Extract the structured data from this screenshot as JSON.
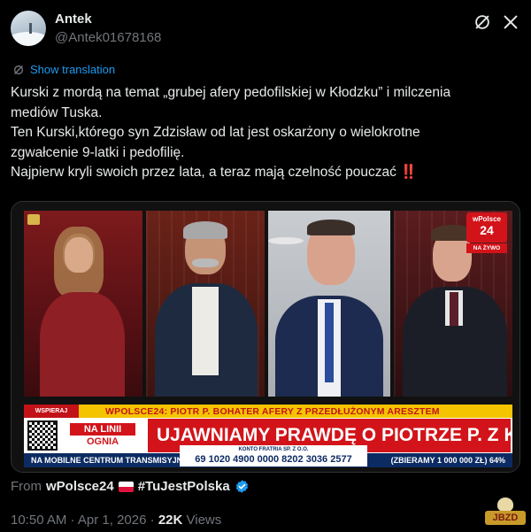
{
  "author": {
    "display_name": "Antek",
    "handle": "@Antek01678168"
  },
  "header": {
    "grok_icon": "grok-slash-circle-icon",
    "more_icon": "close-x-icon"
  },
  "translation": {
    "label": "Show translation"
  },
  "tweet": {
    "lines": [
      "Kurski z mordą na temat „grubej afery pedofilskiej w Kłodzku” i milczenia",
      "mediów Tuska.",
      "Ten Kurski,którego syn Zdzisław od lat jest oskarżony o wielokrotne",
      "zgwałcenie 9-latki i pedofilię.",
      "Najpierw kryli swoich przez lata, a teraz mają czelność pouczać"
    ],
    "emoji": "‼️"
  },
  "media": {
    "brand_line1": "wPolsce",
    "brand_line2": "24",
    "live": "NA ŻYWO",
    "support": "WSPIERAJ wPolsce24",
    "ticker_head": "WPOLSCE24: PIOTR P. BOHATER AFERY Z PRZEDŁUŻONYM ARESZTEM",
    "na_linii_1": "NA LINII",
    "na_linii_2": "OGNIA",
    "headline": "UJAWNIAMY PRAWDĘ O PIOTRZE P. Z KO",
    "mobile": "NA MOBILNE CENTRUM TRANSMISYJNE",
    "account_label": "KONTO FRATRIA SP. Z O.O.",
    "account_number": "69 1020 4900 0000 8202 3036 2577",
    "collect": "(ZBIERAMY 1 000 000 ZŁ) 64%"
  },
  "source": {
    "from": "From",
    "name": "wPolsce24",
    "hashtag": "#TuJestPolska"
  },
  "meta": {
    "time": "10:50 AM",
    "date": "Apr 1, 2026",
    "views_count": "22K",
    "views_label": "Views"
  },
  "watermark": {
    "text": "JBZD"
  },
  "colors": {
    "background": "#000000",
    "text": "#e7e9ea",
    "muted": "#71767b",
    "link": "#1d9bf0",
    "tv_red": "#d2141a",
    "tv_yellow": "#f4c400",
    "tv_navy": "#0d2b63"
  }
}
